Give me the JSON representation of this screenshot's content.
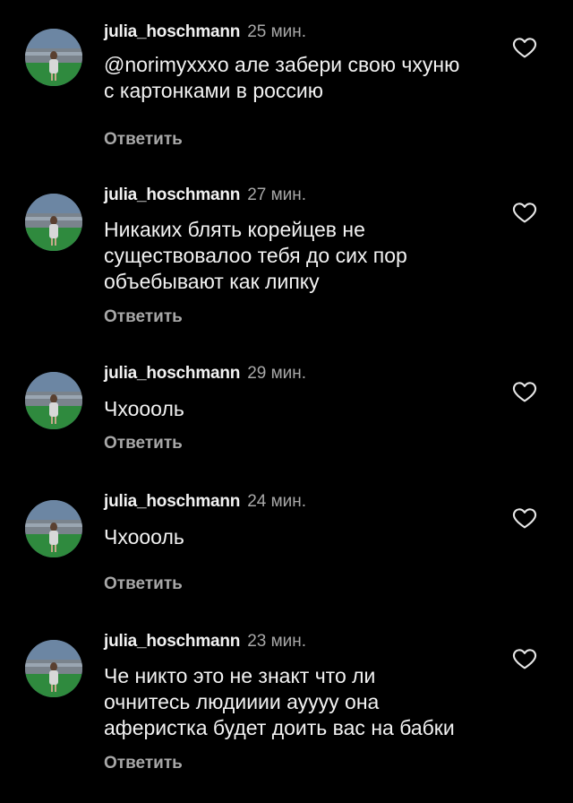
{
  "colors": {
    "background": "#000000",
    "text": "#f2f2f2",
    "secondary": "#a8a8a8"
  },
  "comments": [
    {
      "username": "julia_hoschmann",
      "time": "25 мин.",
      "lines": [
        "@norimyxxxo але забери свою чхуню",
        "с картонками в россию"
      ],
      "reply_label": "Ответить",
      "like_icon": "heart-outline-icon"
    },
    {
      "username": "julia_hoschmann",
      "time": "27 мин.",
      "lines": [
        "Никаких блять корейцев не",
        "существовалоо тебя до сих пор",
        "объебывают как липку"
      ],
      "reply_label": "Ответить",
      "like_icon": "heart-outline-icon"
    },
    {
      "username": "julia_hoschmann",
      "time": "29 мин.",
      "lines": [
        "Чхоооль"
      ],
      "reply_label": "Ответить",
      "like_icon": "heart-outline-icon"
    },
    {
      "username": "julia_hoschmann",
      "time": "24 мин.",
      "lines": [
        "Чхоооль"
      ],
      "reply_label": "Ответить",
      "like_icon": "heart-outline-icon"
    },
    {
      "username": "julia_hoschmann",
      "time": "23 мин.",
      "lines": [
        "Че никто это не знакт что ли",
        "очнитесь людииии ауууу она",
        "аферистка будет доить вас на бабки"
      ],
      "reply_label": "Ответить",
      "like_icon": "heart-outline-icon"
    }
  ]
}
